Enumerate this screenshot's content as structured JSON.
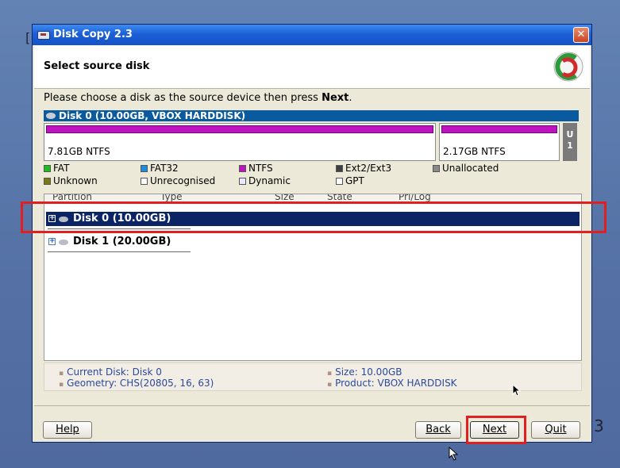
{
  "window": {
    "title": "Disk Copy 2.3",
    "heading": "Select source disk",
    "instruction_prefix": "Please choose a disk as the source device then press ",
    "instruction_bold": "Next",
    "instruction_suffix": "."
  },
  "disk_bar": {
    "label": "Disk 0 (10.00GB, VBOX HARDDISK)"
  },
  "partitions": [
    {
      "label": "7.81GB NTFS",
      "color": "#c012c0"
    },
    {
      "label": "2.17GB NTFS",
      "color": "#c012c0"
    }
  ],
  "unallocated_tab": "U\n1",
  "legend": [
    {
      "label": "FAT",
      "color": "#18c018"
    },
    {
      "label": "FAT32",
      "color": "#1a8ee0"
    },
    {
      "label": "NTFS",
      "color": "#c012c0"
    },
    {
      "label": "Ext2/Ext3",
      "color": "#404040"
    },
    {
      "label": "Unallocated",
      "color": "#8a8a8a"
    },
    {
      "label": "Unknown",
      "color": "#7a7a10"
    },
    {
      "label": "Unrecognised",
      "color": "#ffffff"
    },
    {
      "label": "Dynamic",
      "color": "#e8e8ff"
    },
    {
      "label": "GPT",
      "color": "#ffffff"
    }
  ],
  "columns": [
    "Partition",
    "Type",
    "Size",
    "State",
    "Pri/Log"
  ],
  "tree": [
    {
      "label": "Disk 0 (10.00GB)",
      "selected": true
    },
    {
      "label": "Disk 1 (20.00GB)",
      "selected": false
    }
  ],
  "info": {
    "current_disk": "Current Disk: Disk 0",
    "geometry": "Geometry: CHS(20805, 16, 63)",
    "size": "Size: 10.00GB",
    "product": "Product: VBOX HARDDISK"
  },
  "buttons": {
    "help": "Help",
    "back": "Back",
    "next": "Next",
    "quit": "Quit"
  },
  "colors": {
    "titlebar": "#1c5fd6",
    "selection": "#0a2466",
    "highlight": "#e02020"
  }
}
